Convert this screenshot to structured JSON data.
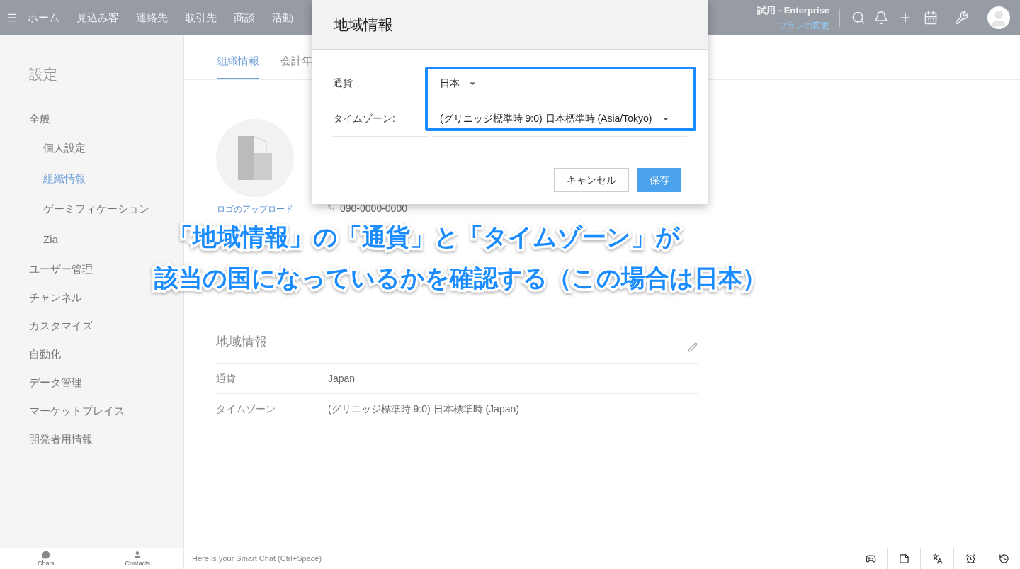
{
  "top_nav": {
    "menu_items": [
      "ホーム",
      "見込み客",
      "連絡先",
      "取引先",
      "商談",
      "活動"
    ],
    "plan": "試用 - Enterprise",
    "upgrade_link": "プランの変更"
  },
  "sidebar": {
    "title": "設定",
    "sections": [
      {
        "label": "全般",
        "selected": false,
        "children": [
          {
            "label": "個人設定",
            "selected": false
          },
          {
            "label": "組織情報",
            "selected": true
          },
          {
            "label": "ゲーミフィケーション",
            "selected": false
          },
          {
            "label": "Zia",
            "selected": false
          }
        ]
      },
      {
        "label": "ユーザー管理",
        "selected": false
      },
      {
        "label": "チャンネル",
        "selected": false
      },
      {
        "label": "カスタマイズ",
        "selected": false
      },
      {
        "label": "自動化",
        "selected": false
      },
      {
        "label": "データ管理",
        "selected": false
      },
      {
        "label": "マーケットプレイス",
        "selected": false
      },
      {
        "label": "開発者用情報",
        "selected": false
      }
    ]
  },
  "tabs": [
    {
      "label": "組織情報",
      "selected": true
    },
    {
      "label": "会計年",
      "selected": false
    }
  ],
  "org": {
    "logo_caption": "ロゴのアップロード",
    "phone": "090-0000-0000"
  },
  "locale_section": {
    "title": "地域情報",
    "rows": [
      {
        "label": "通貨",
        "value": "Japan"
      },
      {
        "label": "タイムゾーン",
        "value": "(グリニッジ標準時 9:0) 日本標準時 (Japan)"
      }
    ]
  },
  "modal": {
    "title": "地域情報",
    "fields": [
      {
        "label": "通貨",
        "value": "日本"
      },
      {
        "label": "タイムゾーン:",
        "value": "(グリニッジ標準時 9:0) 日本標準時 (Asia/Tokyo)"
      }
    ],
    "buttons": [
      {
        "label": "キャンセル",
        "kind": "secondary"
      },
      {
        "label": "保存",
        "kind": "primary"
      }
    ]
  },
  "caption": {
    "lines": [
      "「地域情報」の「通貨」と「タイムゾーン」が",
      "該当の国になっているかを確認する（この場合は日本）"
    ]
  },
  "bottom_bar": {
    "tabs": [
      {
        "label": "Chats",
        "kind": "chats"
      },
      {
        "label": "Contacts",
        "kind": "contacts"
      }
    ],
    "chat_placeholder": "Here is your Smart Chat (Ctrl+Space)"
  }
}
